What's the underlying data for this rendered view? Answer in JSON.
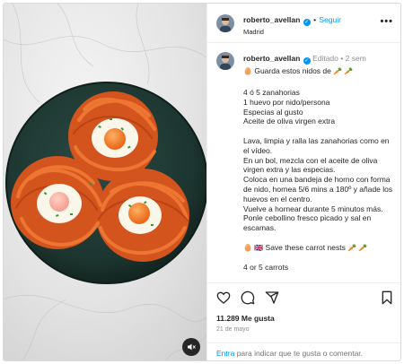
{
  "header": {
    "username": "roberto_avellan",
    "verified_icon": "verified-badge-icon",
    "separator": "•",
    "follow_label": "Seguir",
    "location": "Madrid",
    "more_label": "•••"
  },
  "caption": {
    "username": "roberto_avellan",
    "edited_label": "Editado",
    "separator": "•",
    "age": "2 sem",
    "first_line_prefix": "🥚",
    "first_line": "Guarda estos nidos de",
    "emojis": "🥕 🥕",
    "ingredients": [
      "4 ó 5 zanahorias",
      "1 huevo por nido/persona",
      "Especias al gusto",
      "Aceite de oliva virgen extra"
    ],
    "steps": "Lava, limpia y ralla las zanahorias como en el vídeo.\nEn un bol, mezcla con el aceite de oliva virgen extra y las especias.\nColoca en una bandeja de horno con forma de nido, hornea 5/6 mins a 180º y añade los huevos en el centro.\nVuelve a hornear durante 5 minutos más.\nPonle cebollino fresco picado y sal en escamas.",
    "english_prefix": "🥚 🇬🇧",
    "english_line": "Save these carrot nests",
    "english_emojis": "🥕 🥕",
    "english_first_ingredient": "4 or 5 carrots"
  },
  "actions": {
    "like_icon": "heart-icon",
    "comment_icon": "comment-icon",
    "share_icon": "share-icon",
    "save_icon": "bookmark-icon",
    "likes": "11.289 Me gusta",
    "date": "21 de mayo"
  },
  "comment_box": {
    "link_text": "Entra",
    "rest_text": " para indicar que te gusta o comentar."
  },
  "media": {
    "mute_icon": "speaker-muted-icon"
  },
  "colors": {
    "accent": "#0095f6",
    "text": "#262626",
    "muted": "#8e8e8e",
    "border": "#dbdbdb",
    "plate": "#1f3b35",
    "carrot": "#e2632a"
  }
}
